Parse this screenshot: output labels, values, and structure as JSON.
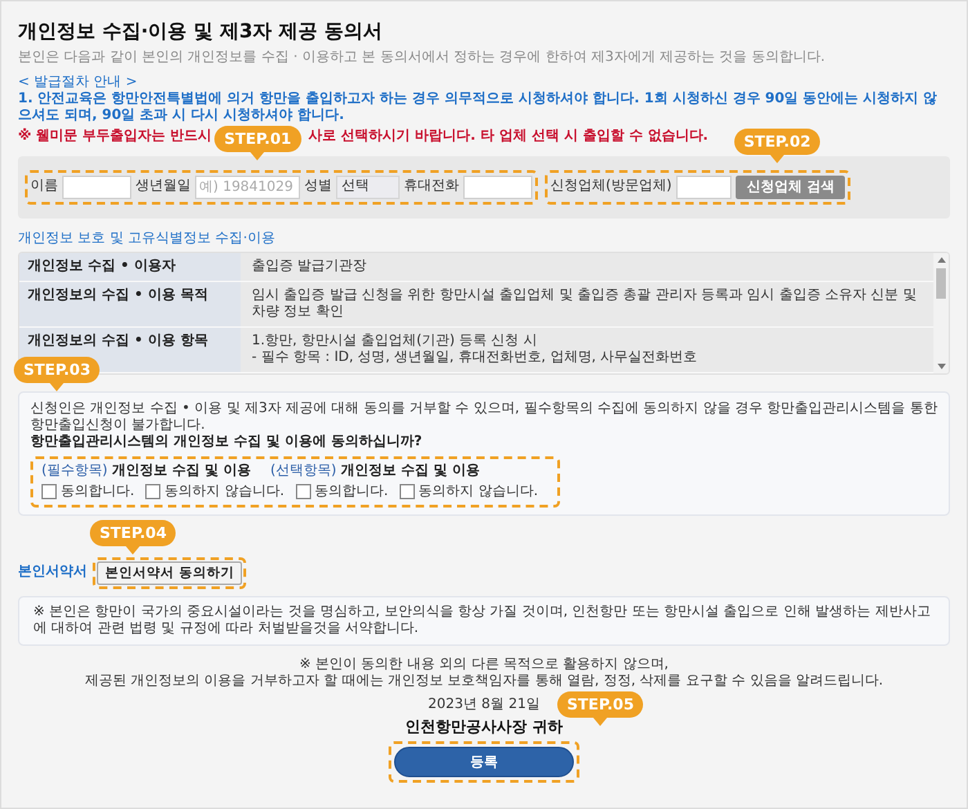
{
  "title": "개인정보 수집·이용 및 제3자 제공 동의서",
  "intro": "본인은 다음과 같이 본인의 개인정보를 수집 · 이용하고 본 동의서에서 정하는 경우에 한하여 제3자에게 제공하는 것을 동의합니다.",
  "procedure": {
    "heading": "< 발급절차 안내 >",
    "text": "1. 안전교육은 항만안전특별법에 의거 항만을 출입하고자 하는 경우 의무적으로 시청하셔야 합니다. 1회 시청하신 경우 90일 동안에는 시청하지 않으셔도 되며, 90일 초과 시 다시 시청하셔야 합니다.",
    "warning_parts": [
      "※ 웰미문 부두출입자는 반드시",
      "사로 선택하시기 바랍니다. 타 업체 선택 시 출입할 수 없습니다."
    ]
  },
  "applicant": {
    "step": "STEP.01",
    "fields": [
      {
        "kind": "text",
        "label": "이름"
      },
      {
        "kind": "text",
        "label": "생년월일",
        "placeholder": "예) 19841029"
      },
      {
        "kind": "select",
        "label": "성별",
        "value": "선택"
      },
      {
        "kind": "text",
        "label": "휴대전화"
      }
    ]
  },
  "company": {
    "step": "STEP.02",
    "label": "신청업체(방문업체)",
    "button": "신청업체 검색"
  },
  "privacy": {
    "heading": "개인정보 보호 및 고유식별정보 수집·이용",
    "rows": [
      {
        "label": "개인정보 수집 • 이용자",
        "lines": [
          "출입증 발급기관장"
        ]
      },
      {
        "label": "개인정보의 수집 • 이용 목적",
        "lines": [
          "임시 출입증 발급 신청을 위한 항만시설 출입업체 및 출입증 총괄 관리자 등록과 임시 출입증 소유자 신분 및 차량 정보 확인"
        ]
      },
      {
        "label": "개인정보의 수집 • 이용 항목",
        "lines": [
          "1.항만, 항만시설 출입업체(기관) 등록 신청 시",
          "- 필수 항목 : ID, 성명, 생년월일, 휴대전화번호, 업체명, 사무실전화번호"
        ]
      }
    ]
  },
  "consent": {
    "step": "STEP.03",
    "notice": "신청인은 개인정보 수집 • 이용 및 제3자 제공에 대해 동의를 거부할 수 있으며, 필수항목의 수집에 동의하지 않을 경우 항만출입관리시스템을 통한 항만출입신청이 불가합니다.",
    "question": "항만출입관리시스템의 개인정보 수집 및 이용에 동의하십니까?",
    "groups": [
      {
        "tag": "(필수항목)",
        "title": "개인정보 수집 및 이용",
        "options": [
          {
            "label": "동의합니다.",
            "checked": false
          },
          {
            "label": "동의하지 않습니다.",
            "checked": false
          }
        ]
      },
      {
        "tag": "(선택항목)",
        "title": "개인정보 수집 및 이용",
        "options": [
          {
            "label": "동의합니다.",
            "checked": false
          },
          {
            "label": "동의하지 않습니다.",
            "checked": false
          }
        ]
      }
    ]
  },
  "pledge": {
    "step": "STEP.04",
    "label": "본인서약서",
    "button": "본인서약서 동의하기",
    "text": "※ 본인은 항만이 국가의 중요시설이라는 것을 명심하고, 보안의식을 항상 가질 것이며, 인천항만 또는 항만시설 출입으로 인해 발생하는 제반사고에 대하여 관련 법령 및 규정에 따라 처벌받을것을 서약합니다."
  },
  "notes": [
    "※ 본인이 동의한 내용 외의 다른 목적으로 활용하지 않으며,",
    "제공된 개인정보의 이용을 거부하고자 할 때에는 개인정보 보호책임자를 통해 열람, 정정, 삭제를 요구할 수 있음을 알려드립니다."
  ],
  "date": "2023년 8월 21일",
  "addressee": "인천항만공사사장 귀하",
  "submit": {
    "step": "STEP.05",
    "label": "등록"
  }
}
